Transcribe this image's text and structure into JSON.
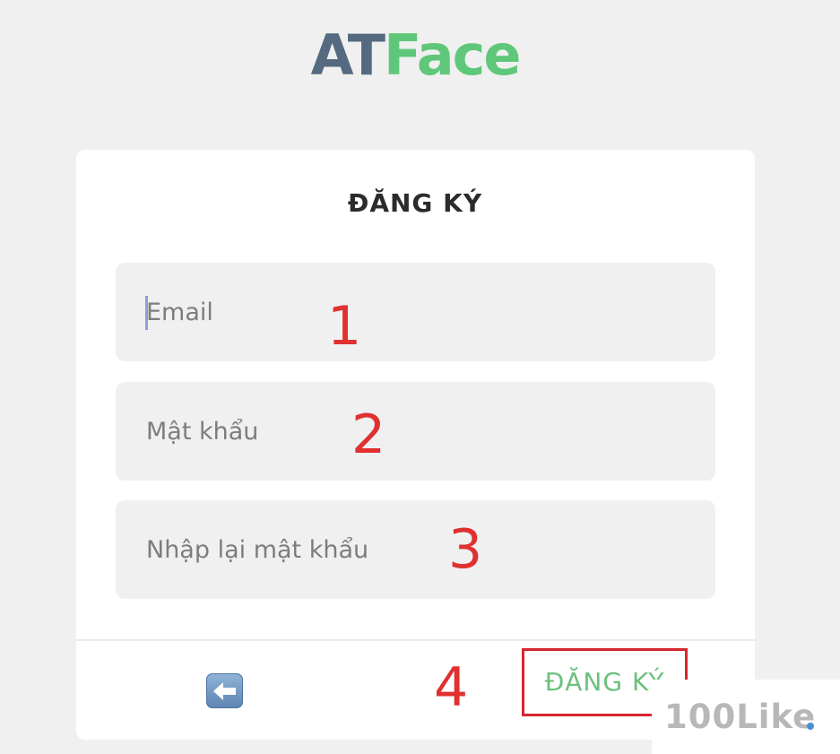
{
  "logo": {
    "part1": "AT",
    "part2": "Face"
  },
  "form": {
    "title": "ĐĂNG KÝ",
    "email_placeholder": "Email",
    "password_placeholder": "Mật khẩu",
    "confirm_placeholder": "Nhập lại mật khẩu",
    "submit_label": "ĐĂNG KÝ"
  },
  "annotations": {
    "n1": "1",
    "n2": "2",
    "n3": "3",
    "n4": "4"
  },
  "watermark": {
    "text": "100Like"
  },
  "colors": {
    "logo_at": "#556a80",
    "logo_face": "#5fc779",
    "annotation_red": "#e03030",
    "submit_green": "#6bc17c"
  },
  "icons": {
    "back": "back-arrow-icon"
  }
}
